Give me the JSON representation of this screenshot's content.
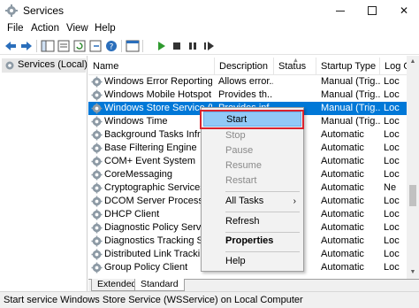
{
  "window": {
    "title": "Services"
  },
  "menu": [
    "File",
    "Action",
    "View",
    "Help"
  ],
  "tree": {
    "label": "Services (Local)"
  },
  "columns": [
    "Name",
    "Description",
    "Status",
    "Startup Type",
    "Log O"
  ],
  "services": [
    {
      "name": "Windows Error Reporting Se...",
      "desc": "Allows error...",
      "status": "",
      "startup": "Manual (Trig...",
      "log": "Loc"
    },
    {
      "name": "Windows Mobile Hotspot S...",
      "desc": "Provides th...",
      "status": "",
      "startup": "Manual (Trig...",
      "log": "Loc"
    },
    {
      "name": "Windows Store Service (WS...",
      "desc": "Provides inf...",
      "status": "",
      "startup": "Manual (Trig...",
      "log": "Loc"
    },
    {
      "name": "Windows Time",
      "desc": "",
      "status": "",
      "startup": "Manual (Trig...",
      "log": "Loc"
    },
    {
      "name": "Background Tasks Infrastru...",
      "desc": "",
      "status": "",
      "startup": "Automatic",
      "log": "Loc"
    },
    {
      "name": "Base Filtering Engine",
      "desc": "",
      "status": "",
      "startup": "Automatic",
      "log": "Loc"
    },
    {
      "name": "COM+ Event System",
      "desc": "",
      "status": "",
      "startup": "Automatic",
      "log": "Loc"
    },
    {
      "name": "CoreMessaging",
      "desc": "",
      "status": "",
      "startup": "Automatic",
      "log": "Loc"
    },
    {
      "name": "Cryptographic Services",
      "desc": "",
      "status": "",
      "startup": "Automatic",
      "log": "Ne"
    },
    {
      "name": "DCOM Server Process Laun...",
      "desc": "",
      "status": "",
      "startup": "Automatic",
      "log": "Loc"
    },
    {
      "name": "DHCP Client",
      "desc": "",
      "status": "",
      "startup": "Automatic",
      "log": "Loc"
    },
    {
      "name": "Diagnostic Policy Service",
      "desc": "",
      "status": "",
      "startup": "Automatic",
      "log": "Loc"
    },
    {
      "name": "Diagnostics Tracking Servi...",
      "desc": "",
      "status": "",
      "startup": "Automatic",
      "log": "Loc"
    },
    {
      "name": "Distributed Link Tracking ...",
      "desc": "",
      "status": "",
      "startup": "Automatic",
      "log": "Loc"
    },
    {
      "name": "Group Policy Client",
      "desc": "",
      "status": "",
      "startup": "Automatic",
      "log": "Loc"
    }
  ],
  "context_menu": {
    "start": "Start",
    "stop": "Stop",
    "pause": "Pause",
    "resume": "Resume",
    "restart": "Restart",
    "all_tasks": "All Tasks",
    "refresh": "Refresh",
    "properties": "Properties",
    "help": "Help"
  },
  "tabs": [
    "Extended",
    "Standard"
  ],
  "status_bar": "Start service Windows Store Service (WSService) on Local Computer",
  "colors": {
    "selection": "#0078d7",
    "menu_highlight": "#91c9f7",
    "callout": "#d9232f"
  }
}
